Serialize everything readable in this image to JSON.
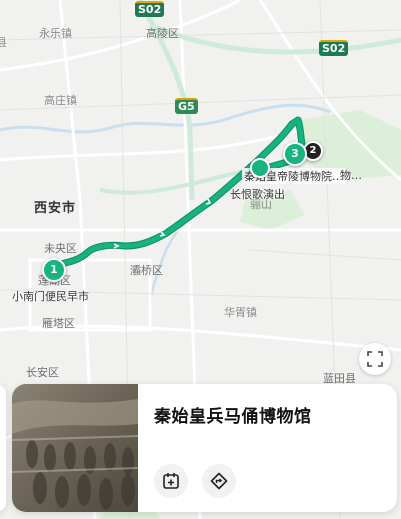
{
  "map": {
    "labels": {
      "yuele": "永乐镇",
      "gaoling": "高陵区",
      "gaozhuang": "高庄镇",
      "xian": "西安市",
      "weiyang": "未央区",
      "lianhu": "莲湖区",
      "baqiao": "灞桥区",
      "yanta": "雁塔区",
      "changan": "长安区",
      "huaxu": "华胥镇",
      "lantian": "蓝田县",
      "lishan": "骊山",
      "changhenge": "长恨歌演出",
      "qinling": "秦始皇帝陵博物院…",
      "xiaonanmen": "小南门便民早市",
      "museum_partial": "物…",
      "edge_left": "县"
    },
    "road_shields": {
      "s02_top": "S02",
      "s02_right": "S02",
      "g5": "G5"
    },
    "markers": {
      "m1": "1",
      "m2": "2",
      "m3": "3"
    },
    "colors": {
      "route": "#16b27f",
      "route_outline": "#0e8c62",
      "marker": "#17b47f"
    }
  },
  "controls": {
    "fullscreen_icon": "expand-icon"
  },
  "card": {
    "title": "秦始皇兵马俑博物馆",
    "add_icon": "calendar-add-icon",
    "nav_icon": "directions-icon"
  }
}
